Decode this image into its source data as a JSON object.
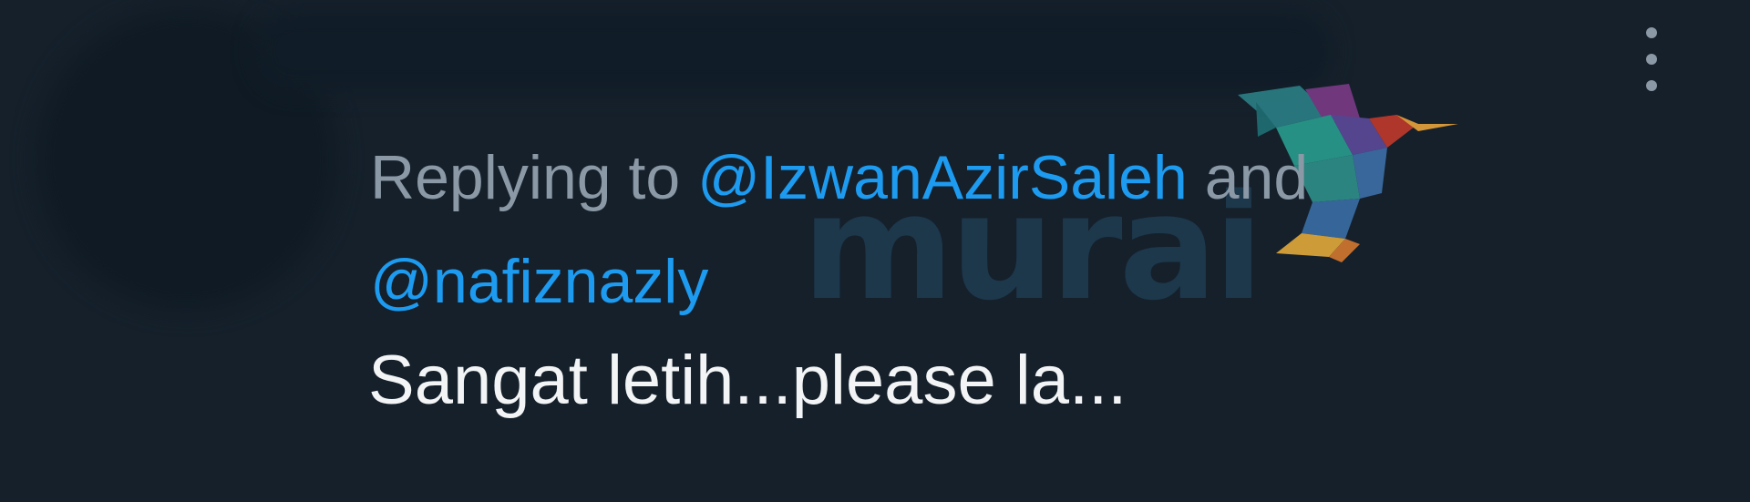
{
  "tweet": {
    "reply_prefix": "Replying to",
    "mentions": [
      "@IzwanAzirSaleh",
      "@nafiznazly"
    ],
    "conjunction": "and",
    "text": "Sangat letih...please la..."
  },
  "watermark": {
    "word": "murai",
    "icon": "hummingbird-logo-icon"
  },
  "menu": {
    "icon": "more-vertical-icon"
  },
  "colors": {
    "background": "#15202b",
    "mention": "#1d9bf0",
    "muted_text": "#8b98a5",
    "primary_text": "#f2f4f5"
  }
}
